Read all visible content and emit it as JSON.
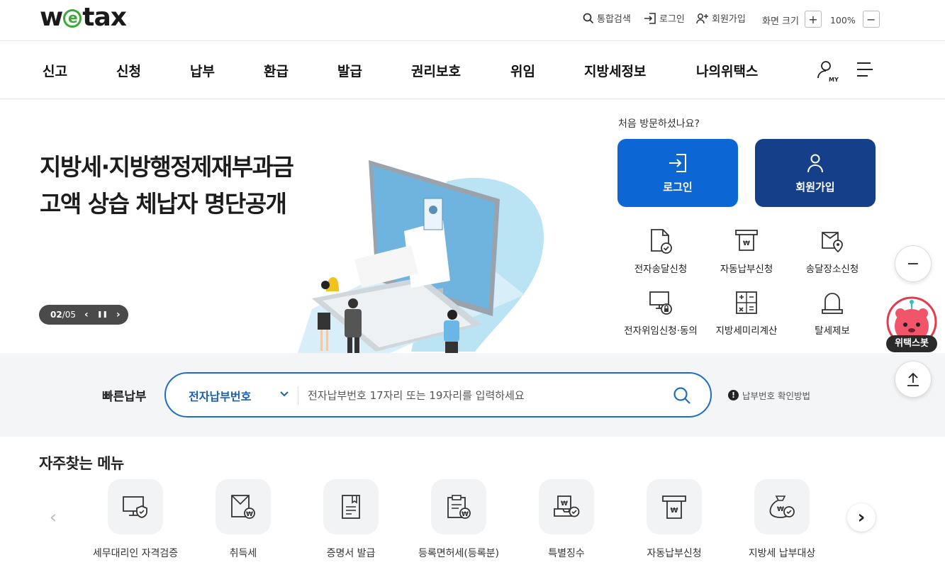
{
  "brand": {
    "logo_prefix": "w",
    "logo_e": "e",
    "logo_suffix": "tax"
  },
  "utility": {
    "search": "통합검색",
    "login": "로그인",
    "signup": "회원가입",
    "zoom_label": "화면 크기",
    "zoom_in": "+",
    "zoom_value": "100%",
    "zoom_out": "−"
  },
  "nav": {
    "items": [
      "신고",
      "신청",
      "납부",
      "환급",
      "발급",
      "권리보호",
      "위임",
      "지방세정보",
      "나의위택스"
    ],
    "my_badge": "MY"
  },
  "hero": {
    "title_line1": "지방세·지방행정제재부과금",
    "title_line2": "고액 상습 체납자 명단공개",
    "slide_current": "02",
    "slide_sep": " / ",
    "slide_total": "05",
    "prev": "‹",
    "pause": "❚❚",
    "next": "›"
  },
  "member": {
    "question": "처음 방문하셨나요?",
    "login_label": "로그인",
    "signup_label": "회원가입",
    "login_color": "#0c66d3",
    "signup_color": "#163f8a"
  },
  "quick_menu": [
    {
      "label": "전자송달신청",
      "icon": "document-check-icon"
    },
    {
      "label": "자동납부신청",
      "icon": "auto-pay-icon"
    },
    {
      "label": "송달장소신청",
      "icon": "document-location-icon"
    },
    {
      "label": "전자위임신청·동의",
      "icon": "monitor-lock-icon"
    },
    {
      "label": "지방세미리계산",
      "icon": "calculator-icon"
    },
    {
      "label": "탈세제보",
      "icon": "bell-icon"
    }
  ],
  "quick_pay": {
    "label": "빠른납부",
    "select_value": "전자납부번호",
    "placeholder": "전자납부번호 17자리 또는 19자리를 입력하세요",
    "help_icon": "!",
    "help_text": "납부번호 확인방법"
  },
  "frequent": {
    "title": "자주찾는 메뉴",
    "prev": "‹",
    "next": "›",
    "items": [
      {
        "label": "세무대리인 자격검증",
        "icon": "monitor-shield-icon"
      },
      {
        "label": "취득세",
        "icon": "doc-won-icon"
      },
      {
        "label": "증명서 발급",
        "icon": "certificate-icon"
      },
      {
        "label": "등록면허세(등록분)",
        "icon": "clipboard-won-icon"
      },
      {
        "label": "특별징수",
        "icon": "tray-won-icon"
      },
      {
        "label": "자동납부신청",
        "icon": "auto-pay-icon"
      },
      {
        "label": "지방세 납부대상",
        "icon": "money-bag-icon"
      }
    ]
  },
  "floating": {
    "zoom_out": "−",
    "bot_label": "위택스봇",
    "top": "↑"
  }
}
